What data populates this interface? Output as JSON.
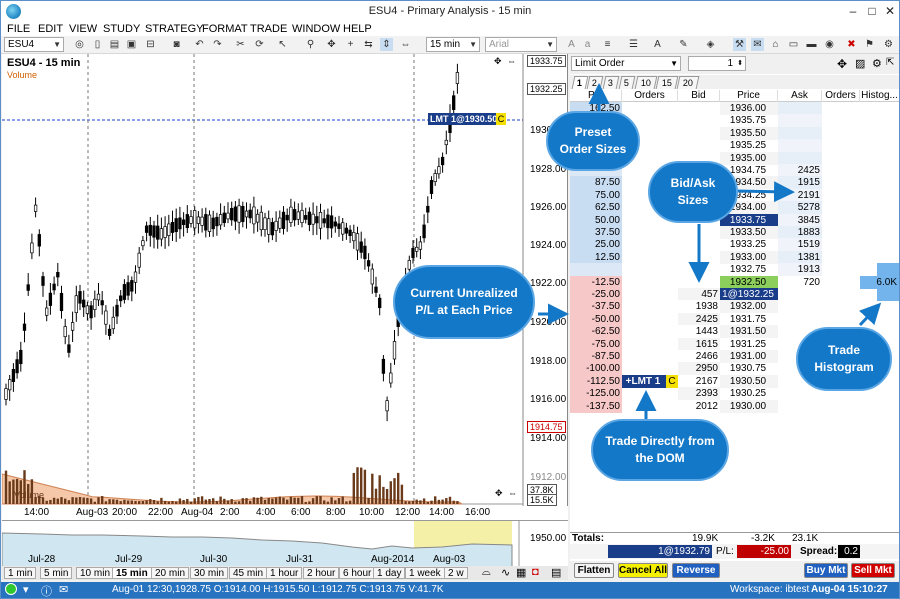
{
  "window": {
    "title": "ESU4 - Primary Analysis - 15 min"
  },
  "menu": [
    "FILE",
    "EDIT",
    "VIEW",
    "STUDY",
    "STRATEGY",
    "FORMAT",
    "TRADE",
    "WINDOW",
    "HELP"
  ],
  "toolbar": {
    "symbol": "ESU4",
    "interval": "15 min",
    "font": "Arial"
  },
  "chart": {
    "title": "ESU4 - 15 min",
    "study": "Volume",
    "y_labels": [
      "1933.75",
      "1932.25",
      "1930",
      "1928.00",
      "1926.00",
      "1924.00",
      "1922.00",
      "1920.00",
      "1918.00",
      "1916.00",
      "1914.75",
      "1914.00",
      "1912.00"
    ],
    "order_marker": "LMT 1@1930.50",
    "order_marker_tag": "C",
    "volume_labels": [
      "37.8K",
      "15.5K"
    ],
    "volume_axis_label": "Volume",
    "x_labels": [
      "14:00",
      "Aug-03",
      "20:00",
      "22:00",
      "Aug-04",
      "2:00",
      "4:00",
      "6:00",
      "8:00",
      "10:00",
      "12:00",
      "14:00",
      "16:00"
    ]
  },
  "overview": {
    "labels": [
      "Jul-28",
      "Jul-29",
      "Jul-30",
      "Jul-31",
      "Aug-2014",
      "Aug-03"
    ],
    "y_label": "1950.00"
  },
  "intervals": [
    "1 min",
    "5 min",
    "10 min",
    "15 min",
    "20 min",
    "30 min",
    "45 min",
    "1 hour",
    "2 hour",
    "6 hour",
    "1 day",
    "1 week",
    "2 w"
  ],
  "selected_interval": "15 min",
  "status": {
    "ohlc": "Aug-01 12:30,1928.75 O:1914.00 H:1915.50 L:1912.75 C:1913.75 V:41.7K",
    "workspace": "Workspace: ibtest",
    "datetime": "Aug-04 15:10:27"
  },
  "dom": {
    "order_type": "Limit Order",
    "quantity": "1",
    "tabs": [
      "1",
      "2",
      "3",
      "5",
      "10",
      "15",
      "20"
    ],
    "headers": [
      "P/L",
      "Orders",
      "Bid",
      "Price",
      "Ask",
      "Orders",
      "Histog..."
    ],
    "rows": [
      {
        "pl": "162.50",
        "ord": "",
        "bid": "",
        "price": "1936.00",
        "ask": "",
        "aord": "",
        "hist": ""
      },
      {
        "pl": "",
        "ord": "",
        "bid": "",
        "price": "1935.75",
        "ask": "",
        "aord": "",
        "hist": ""
      },
      {
        "pl": "",
        "ord": "",
        "bid": "",
        "price": "1935.50",
        "ask": "",
        "aord": "",
        "hist": ""
      },
      {
        "pl": "",
        "ord": "",
        "bid": "",
        "price": "1935.25",
        "ask": "",
        "aord": "",
        "hist": ""
      },
      {
        "pl": "",
        "ord": "",
        "bid": "",
        "price": "1935.00",
        "ask": "",
        "aord": "",
        "hist": ""
      },
      {
        "pl": "",
        "ord": "",
        "bid": "",
        "price": "1934.75",
        "ask": "2425",
        "aord": "",
        "hist": ""
      },
      {
        "pl": "87.50",
        "ord": "",
        "bid": "",
        "price": "1934.50",
        "ask": "1915",
        "aord": "",
        "hist": ""
      },
      {
        "pl": "75.00",
        "ord": "",
        "bid": "",
        "price": "1934.25",
        "ask": "2191",
        "aord": "",
        "hist": ""
      },
      {
        "pl": "62.50",
        "ord": "",
        "bid": "",
        "price": "1934.00",
        "ask": "5278",
        "aord": "",
        "hist": ""
      },
      {
        "pl": "50.00",
        "ord": "",
        "bid": "",
        "price": "1933.75",
        "ask": "3845",
        "aord": "",
        "hist": ""
      },
      {
        "pl": "37.50",
        "ord": "",
        "bid": "",
        "price": "1933.50",
        "ask": "1883",
        "aord": "",
        "hist": ""
      },
      {
        "pl": "25.00",
        "ord": "",
        "bid": "",
        "price": "1933.25",
        "ask": "1519",
        "aord": "",
        "hist": ""
      },
      {
        "pl": "12.50",
        "ord": "",
        "bid": "",
        "price": "1933.00",
        "ask": "1381",
        "aord": "",
        "hist": ""
      },
      {
        "pl": "",
        "ord": "",
        "bid": "",
        "price": "1932.75",
        "ask": "1913",
        "aord": "",
        "hist": ""
      },
      {
        "pl": "-12.50",
        "ord": "",
        "bid": "",
        "price": "1932.50",
        "ask": "720",
        "aord": "",
        "hist": "6.0K"
      },
      {
        "pl": "-25.00",
        "ord": "",
        "bid": "457",
        "price": "1@1932.25",
        "ask": "",
        "aord": "",
        "hist": ""
      },
      {
        "pl": "-37.50",
        "ord": "",
        "bid": "1938",
        "price": "1932.00",
        "ask": "",
        "aord": "",
        "hist": ""
      },
      {
        "pl": "-50.00",
        "ord": "",
        "bid": "2425",
        "price": "1931.75",
        "ask": "",
        "aord": "",
        "hist": ""
      },
      {
        "pl": "-62.50",
        "ord": "",
        "bid": "1443",
        "price": "1931.50",
        "ask": "",
        "aord": "",
        "hist": ""
      },
      {
        "pl": "-75.00",
        "ord": "",
        "bid": "1615",
        "price": "1931.25",
        "ask": "",
        "aord": "",
        "hist": ""
      },
      {
        "pl": "-87.50",
        "ord": "",
        "bid": "2466",
        "price": "1931.00",
        "ask": "",
        "aord": "",
        "hist": ""
      },
      {
        "pl": "-100.00",
        "ord": "",
        "bid": "2950",
        "price": "1930.75",
        "ask": "",
        "aord": "",
        "hist": ""
      },
      {
        "pl": "-112.50",
        "ord": "+LMT 1",
        "bid": "2167",
        "price": "1930.50",
        "ask": "",
        "aord": "",
        "hist": ""
      },
      {
        "pl": "-125.00",
        "ord": "",
        "bid": "2393",
        "price": "1930.25",
        "ask": "",
        "aord": "",
        "hist": ""
      },
      {
        "pl": "-137.50",
        "ord": "",
        "bid": "2012",
        "price": "1930.00",
        "ask": "",
        "aord": "",
        "hist": ""
      }
    ],
    "order_tag": "C",
    "totals": {
      "label": "Totals:",
      "bid": "19.9K",
      "diff": "-3.2K",
      "ask": "23.1K"
    },
    "position": {
      "value": "1@1932.79",
      "pl_label": "P/L:",
      "pl": "-25.00",
      "spread_label": "Spread:",
      "spread": "0.2"
    },
    "buttons": {
      "flatten": "Flatten",
      "cancel_all": "Cancel All",
      "reverse": "Reverse",
      "buy_mkt": "Buy Mkt",
      "sell_mkt": "Sell Mkt"
    }
  },
  "callouts": {
    "preset": "Preset Order Sizes",
    "bidask": "Bid/Ask Sizes",
    "unrealized": "Current Unrealized P/L at Each Price",
    "histogram": "Trade Histogram",
    "trade_dom": "Trade Directly from the DOM"
  },
  "colors": {
    "accent": "#1478c8",
    "status_bar": "#2873c0",
    "pos_blue": "#c8dcf2",
    "neg_red": "#f6c8c8",
    "price_hl": "#1a3d8a",
    "last_green": "#8ccf5c"
  }
}
